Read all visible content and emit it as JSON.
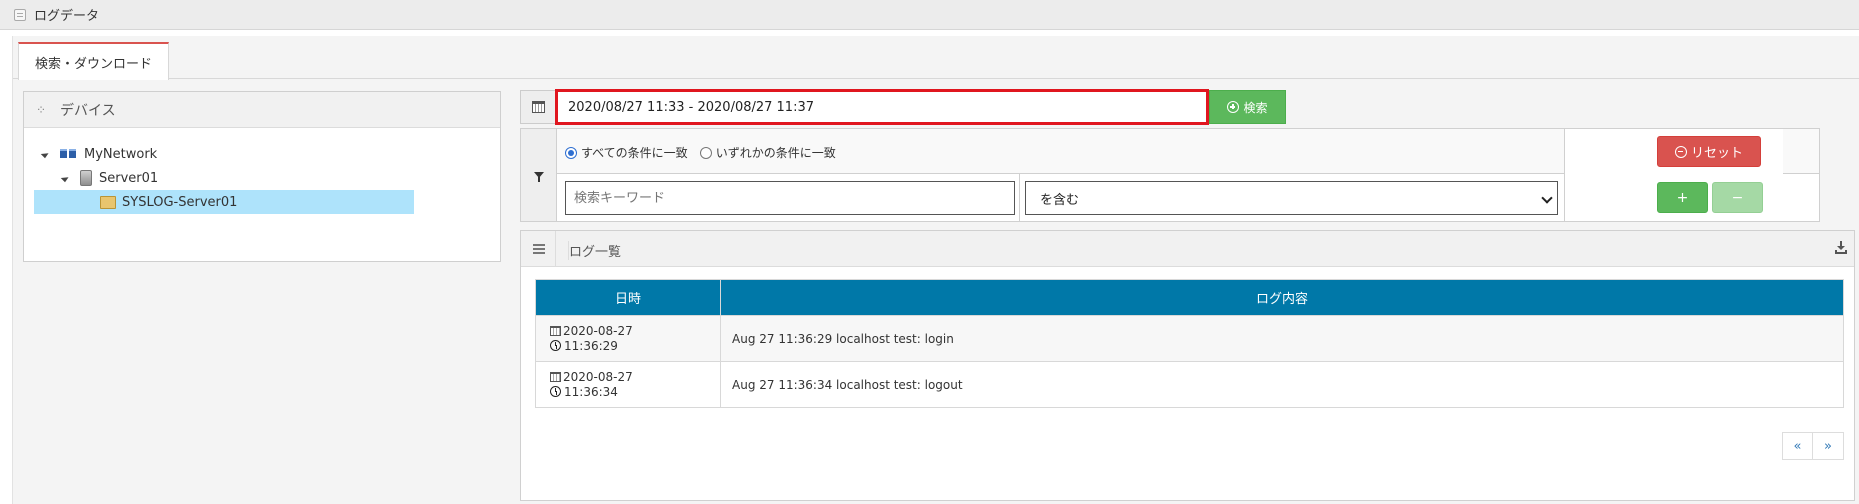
{
  "topbar": {
    "title": "ログデータ",
    "icon": "page-icon"
  },
  "tabs": [
    {
      "label": "検索・ダウンロード",
      "active": true
    }
  ],
  "device_panel": {
    "title": "デバイス",
    "icon": "spinner-icon",
    "tree": [
      {
        "label": "MyNetwork",
        "icon": "network-icon",
        "expanded": true
      },
      {
        "label": "Server01",
        "icon": "server-icon",
        "expanded": true
      },
      {
        "label": "SYSLOG-Server01",
        "icon": "folder-icon",
        "selected": true
      }
    ]
  },
  "search": {
    "date_range": "2020/08/27 11:33 - 2020/08/27 11:37",
    "search_label": "検索",
    "highlight_color": "#e0161f"
  },
  "filter": {
    "match_all": "すべての条件に一致",
    "match_any": "いずれかの条件に一致",
    "selected_match": "all",
    "keyword_placeholder": "検索キーワード",
    "condition_value": "を含む",
    "reset_label": "リセット",
    "add_label": "+",
    "remove_label": "−"
  },
  "log_panel": {
    "title": "ログ一覧",
    "columns": [
      "日時",
      "ログ内容"
    ],
    "rows": [
      {
        "date": "2020-08-27",
        "time": "11:36:29",
        "message": "Aug 27 11:36:29 localhost test: login"
      },
      {
        "date": "2020-08-27",
        "time": "11:36:34",
        "message": "Aug 27 11:36:34 localhost test: logout"
      }
    ],
    "pager": {
      "prev": "«",
      "next": "»"
    },
    "header_color": "#0078a8"
  },
  "colors": {
    "success": "#5cb85c",
    "danger": "#d9534f",
    "selected_row": "#aee3fb"
  }
}
